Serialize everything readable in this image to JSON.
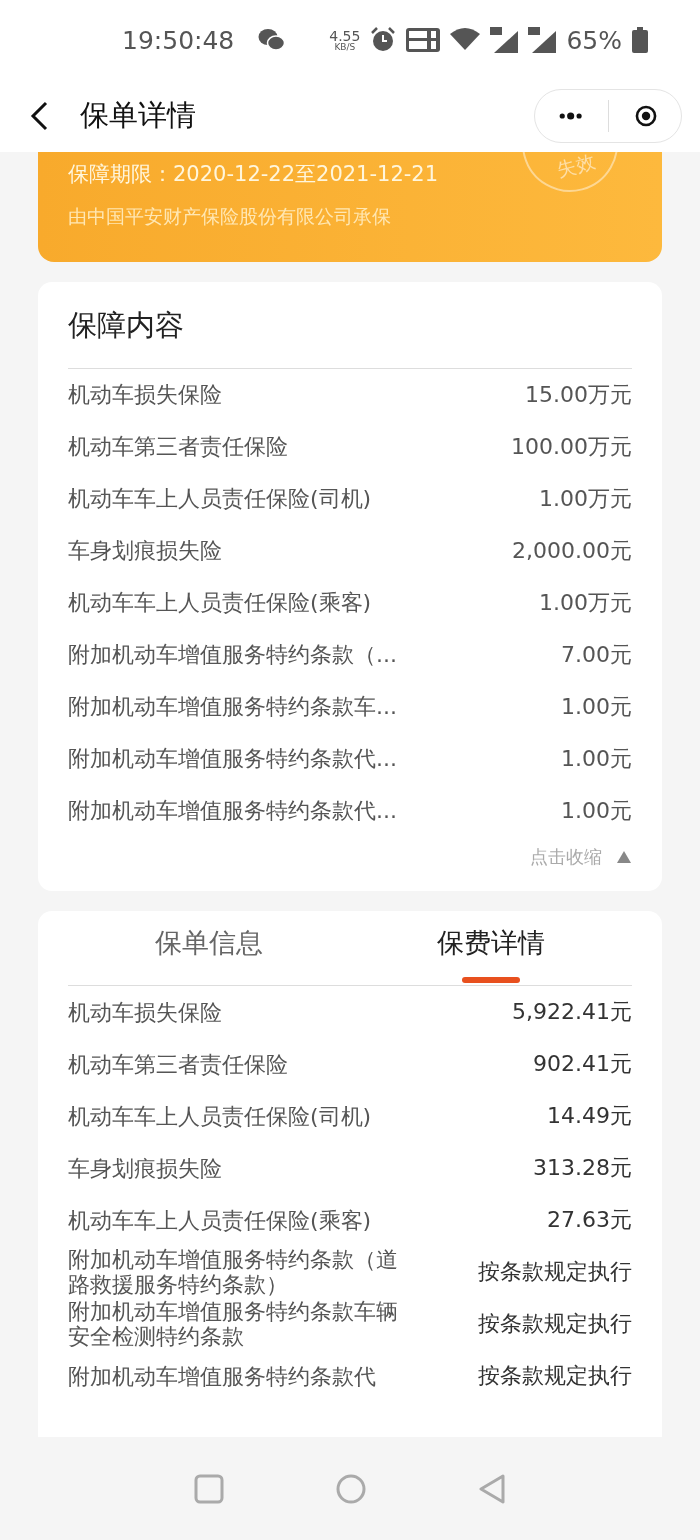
{
  "status_bar": {
    "time": "19:50:48",
    "net_speed": "4.55",
    "net_unit": "KB/S",
    "battery": "65%"
  },
  "nav": {
    "title": "保单详情"
  },
  "policy_banner": {
    "period": "保障期限：2020-12-22至2021-12-21",
    "insurer": "由中国平安财产保险股份有限公司承保",
    "stamp": "失效"
  },
  "coverage": {
    "title": "保障内容",
    "items": [
      {
        "name": "机动车损失保险",
        "amount": "15.00万元"
      },
      {
        "name": "机动车第三者责任保险",
        "amount": "100.00万元"
      },
      {
        "name": "机动车车上人员责任保险(司机)",
        "amount": "1.00万元"
      },
      {
        "name": "车身划痕损失险",
        "amount": "2,000.00元"
      },
      {
        "name": "机动车车上人员责任保险(乘客)",
        "amount": "1.00万元"
      },
      {
        "name": "附加机动车增值服务特约条款（...",
        "amount": "7.00元"
      },
      {
        "name": "附加机动车增值服务特约条款车...",
        "amount": "1.00元"
      },
      {
        "name": "附加机动车增值服务特约条款代...",
        "amount": "1.00元"
      },
      {
        "name": "附加机动车增值服务特约条款代...",
        "amount": "1.00元"
      }
    ],
    "collapse": "点击收缩",
    "expanded": true
  },
  "tabs": [
    {
      "label": "保单信息",
      "selected": false
    },
    {
      "label": "保费详情",
      "selected": true
    }
  ],
  "premiums": [
    {
      "name": "机动车损失保险",
      "amount": "5,922.41元"
    },
    {
      "name": "机动车第三者责任保险",
      "amount": "902.41元"
    },
    {
      "name": "机动车车上人员责任保险(司机)",
      "amount": "14.49元"
    },
    {
      "name": "车身划痕损失险",
      "amount": "313.28元"
    },
    {
      "name": "机动车车上人员责任保险(乘客)",
      "amount": "27.63元"
    },
    {
      "name": "附加机动车增值服务特约条款（道路救援服务特约条款）",
      "amount": "按条款规定执行"
    },
    {
      "name": "附加机动车增值服务特约条款车辆安全检测特约条款",
      "amount": "按条款规定执行"
    },
    {
      "name": "附加机动车增值服务特约条款代",
      "amount": "按条款规定执行"
    }
  ]
}
